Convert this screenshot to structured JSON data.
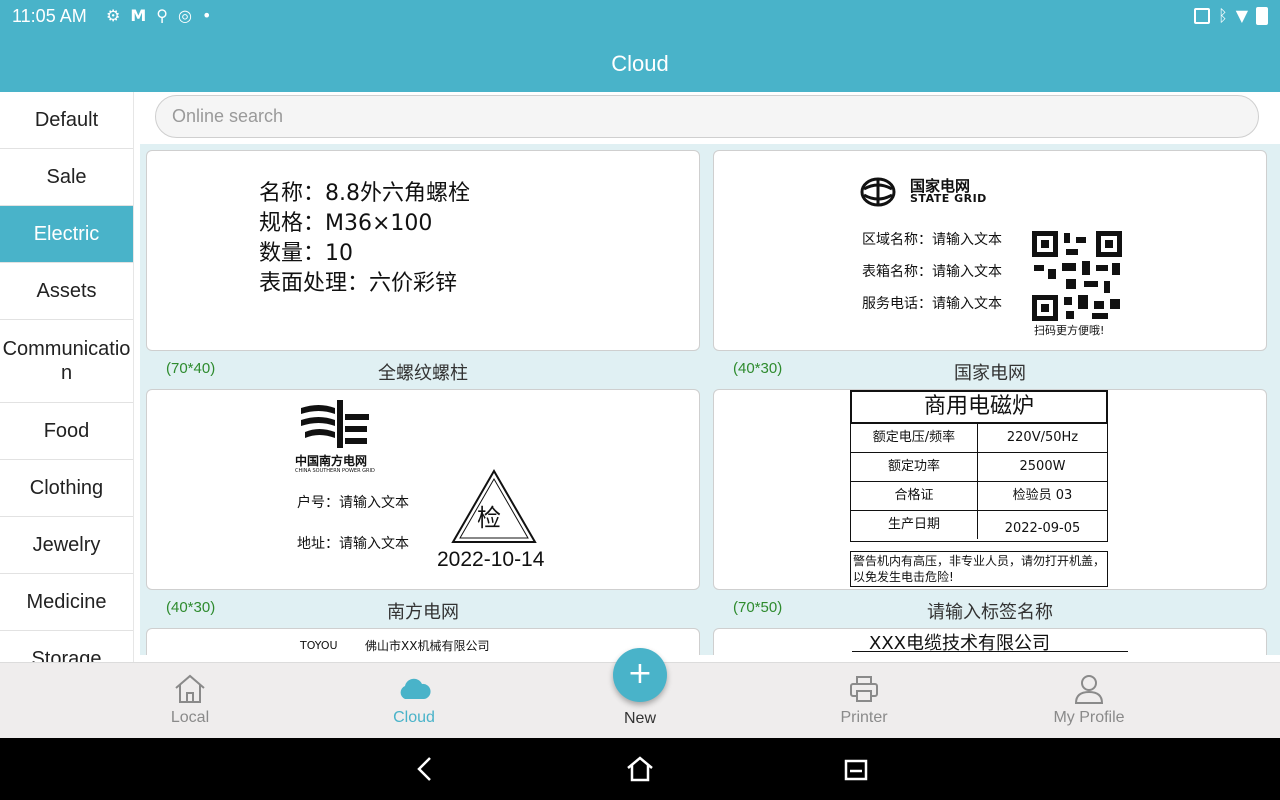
{
  "status": {
    "time": "11:05 AM",
    "left_icons": [
      "settings-icon",
      "gmail-icon",
      "keyhole-icon",
      "sync-icon",
      "dot-icon"
    ],
    "right_icons": [
      "cast-icon",
      "bluetooth-icon",
      "wifi-icon",
      "battery-icon"
    ]
  },
  "appbar": {
    "title": "Cloud"
  },
  "search": {
    "placeholder": "Online search"
  },
  "sidebar": {
    "items": [
      {
        "label": "Default"
      },
      {
        "label": "Sale"
      },
      {
        "label": "Electric",
        "active": true
      },
      {
        "label": "Assets"
      },
      {
        "label": "Communication"
      },
      {
        "label": "Food"
      },
      {
        "label": "Clothing"
      },
      {
        "label": "Jewelry"
      },
      {
        "label": "Medicine"
      },
      {
        "label": "Storage"
      }
    ]
  },
  "templates": [
    {
      "size": "(70*40)",
      "name": "全螺纹螺柱",
      "lines": [
        "名称：8.8外六角螺栓",
        "规格：M36×100",
        "数量：10",
        "表面处理：六价彩锌"
      ]
    },
    {
      "size": "(40*30)",
      "name": "国家电网",
      "logo_cn": "国家电网",
      "logo_en": "STATE GRID",
      "fields": [
        "区域名称：请输入文本",
        "表箱名称：请输入文本",
        "服务电话：请输入文本"
      ],
      "qr_caption": "扫码更方便哦!"
    },
    {
      "size": "(40*30)",
      "name": "南方电网",
      "logo_cn": "中国南方电网",
      "logo_en": "CHINA SOUTHERN POWER GRID",
      "fields": [
        "户号：请输入文本",
        "地址：请输入文本"
      ],
      "mark": "检",
      "date": "2022-10-14"
    },
    {
      "size": "(70*50)",
      "name": "请输入标签名称",
      "title": "商用电磁炉",
      "rows": [
        {
          "k": "额定电压/频率",
          "v": "220V/50Hz"
        },
        {
          "k": "额定功率",
          "v": "2500W"
        },
        {
          "k": "合格证",
          "v": "检验员 03"
        },
        {
          "k": "生产日期",
          "v": "2022-09-05"
        }
      ],
      "warning": "警告机内有高压，非专业人员，请勿打开机盖，以免发生电击危险!"
    },
    {
      "brand": "TOYOU",
      "company": "佛山市XX机械有限公司"
    },
    {
      "company": "XXX电缆技术有限公司"
    }
  ],
  "tabs": [
    {
      "label": "Local",
      "icon": "home-icon"
    },
    {
      "label": "Cloud",
      "icon": "cloud-icon",
      "active": true
    },
    {
      "label": "New",
      "icon": "plus-icon"
    },
    {
      "label": "Printer",
      "icon": "printer-icon"
    },
    {
      "label": "My Profile",
      "icon": "person-icon"
    }
  ],
  "navbar": {
    "icons": [
      "back-icon",
      "home-nav-icon",
      "recents-icon"
    ]
  },
  "colors": {
    "accent": "#49b3c9",
    "size_green": "#2e8b2e",
    "panel": "#e0f0f3"
  }
}
